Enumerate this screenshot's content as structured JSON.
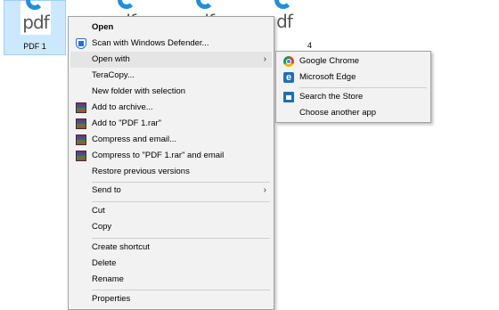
{
  "desktop": {
    "files": [
      {
        "glyph": "pdf",
        "label": "PDF 1"
      },
      {
        "glyph": "df",
        "label": ""
      },
      {
        "glyph": "df",
        "label": ""
      },
      {
        "glyph": "df",
        "label": "4"
      }
    ]
  },
  "context_menu": {
    "items": [
      {
        "label": "Open"
      },
      {
        "label": "Scan with Windows Defender..."
      },
      {
        "label": "Open with"
      },
      {
        "label": "TeraCopy..."
      },
      {
        "label": "New folder with selection"
      },
      {
        "label": "Add to archive..."
      },
      {
        "label": "Add to \"PDF 1.rar\""
      },
      {
        "label": "Compress and email..."
      },
      {
        "label": "Compress to \"PDF 1.rar\" and email"
      },
      {
        "label": "Restore previous versions"
      },
      {
        "label": "Send to"
      },
      {
        "label": "Cut"
      },
      {
        "label": "Copy"
      },
      {
        "label": "Create shortcut"
      },
      {
        "label": "Delete"
      },
      {
        "label": "Rename"
      },
      {
        "label": "Properties"
      }
    ],
    "submenu_arrow": "›"
  },
  "open_with_submenu": {
    "items": [
      {
        "label": "Google Chrome",
        "icon": "chrome-icon"
      },
      {
        "label": "Microsoft Edge",
        "icon": "edge-icon"
      },
      {
        "label": "Search the Store",
        "icon": "store-icon"
      },
      {
        "label": "Choose another app",
        "icon": ""
      }
    ]
  },
  "colors": {
    "selection_bg": "#cce8ff",
    "menu_bg": "#f2f2f2",
    "hover_bg": "#e5e5e5"
  }
}
